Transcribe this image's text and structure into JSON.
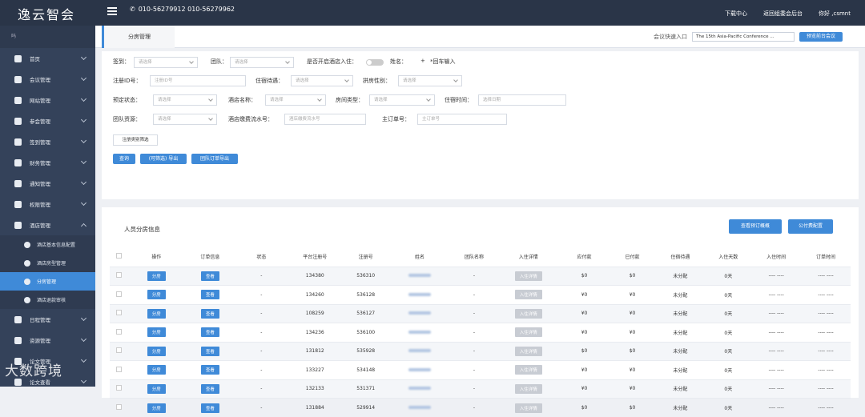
{
  "header": {
    "logo": "逸云智会",
    "phone": "010-56279912  010-56279962",
    "links": [
      "下载中心",
      "返回组委会后台",
      "你好 ,csmnt"
    ]
  },
  "sidebar": {
    "top": "吗",
    "items": [
      {
        "label": "首页"
      },
      {
        "label": "会议管理"
      },
      {
        "label": "网站管理"
      },
      {
        "label": "参会管理"
      },
      {
        "label": "签到管理"
      },
      {
        "label": "财务管理"
      },
      {
        "label": "通知管理"
      },
      {
        "label": "权限管理"
      },
      {
        "label": "酒店管理"
      }
    ],
    "sub": [
      {
        "label": "酒店基本信息配置"
      },
      {
        "label": "酒店房型管理"
      },
      {
        "label": "分房管理"
      },
      {
        "label": "酒店退款审核"
      }
    ],
    "after": [
      {
        "label": "日程管理"
      },
      {
        "label": "资源管理"
      },
      {
        "label": "论文管理"
      },
      {
        "label": "论文查看"
      }
    ]
  },
  "tab": {
    "label": "分房管理"
  },
  "quick": {
    "label": "会议快速入口",
    "value": "The 15th Asia-Pacific Conference ...",
    "button": "预览前台会议"
  },
  "filters": {
    "signin": "签到：",
    "team": "团队：",
    "hotel_join": "是否开启酒店入住：",
    "name": "姓名：",
    "enter_hint": "*回车输入",
    "reg_id": "注册ID号：",
    "stay_treat": "住宿待遇：",
    "share_gender": "拼房性别：",
    "booking_status": "预定状态：",
    "hotel_name": "酒店名称：",
    "room_type": "房间类型：",
    "stay_time": "住宿时间：",
    "team_resource": "团队资源：",
    "pay_serial": "酒店缴费流水号：",
    "main_order": "主订单号：",
    "ph_select": "请选择",
    "ph_id": "注册ID号",
    "ph_date": "选择日期",
    "ph_serial": "酒店缴费流水号",
    "ph_order": "主订单号",
    "plus": "+",
    "reg_type_btn": "注册类别筛选",
    "query": "查询",
    "export": "(可筛选) 导出",
    "team_export": "团队订单导出"
  },
  "panel": {
    "title": "人员分房信息",
    "btn1": "查看预订概概",
    "btn2": "公付费配置"
  },
  "table": {
    "headers": [
      "操作",
      "订单信息",
      "状态",
      "平台注册号",
      "注册号",
      "姓名",
      "团队名称",
      "入住详情",
      "应付款",
      "已付款",
      "住宿待遇",
      "入住天数",
      "入住时间",
      "订单时间"
    ],
    "btn_op": "分房",
    "btn_view": "查看",
    "btn_detail": "入住详情",
    "rows": [
      {
        "status": "-",
        "reg": "134380",
        "no": "536310",
        "team": "-",
        "due": "$0",
        "paid": "$0",
        "treat": "未分配",
        "days": "0天",
        "in": "---- ----",
        "ot": "---- ----"
      },
      {
        "status": "-",
        "reg": "134260",
        "no": "536128",
        "team": "-",
        "due": "¥0",
        "paid": "¥0",
        "treat": "未分配",
        "days": "0天",
        "in": "---- ----",
        "ot": "---- ----"
      },
      {
        "status": "-",
        "reg": "108259",
        "no": "536127",
        "team": "-",
        "due": "¥0",
        "paid": "¥0",
        "treat": "未分配",
        "days": "0天",
        "in": "---- ----",
        "ot": "---- ----"
      },
      {
        "status": "-",
        "reg": "134236",
        "no": "536100",
        "team": "-",
        "due": "¥0",
        "paid": "¥0",
        "treat": "未分配",
        "days": "0天",
        "in": "---- ----",
        "ot": "---- ----"
      },
      {
        "status": "-",
        "reg": "131812",
        "no": "535928",
        "team": "-",
        "due": "$0",
        "paid": "$0",
        "treat": "未分配",
        "days": "0天",
        "in": "---- ----",
        "ot": "---- ----"
      },
      {
        "status": "-",
        "reg": "133227",
        "no": "534148",
        "team": "-",
        "due": "¥0",
        "paid": "¥0",
        "treat": "未分配",
        "days": "0天",
        "in": "---- ----",
        "ot": "---- ----"
      },
      {
        "status": "-",
        "reg": "132133",
        "no": "531371",
        "team": "-",
        "due": "¥0",
        "paid": "¥0",
        "treat": "未分配",
        "days": "0天",
        "in": "---- ----",
        "ot": "---- ----"
      },
      {
        "status": "-",
        "reg": "131884",
        "no": "529914",
        "team": "-",
        "due": "$0",
        "paid": "$0",
        "treat": "未分配",
        "days": "0天",
        "in": "---- ----",
        "ot": "---- ----"
      }
    ]
  },
  "watermark": "大数跨境"
}
